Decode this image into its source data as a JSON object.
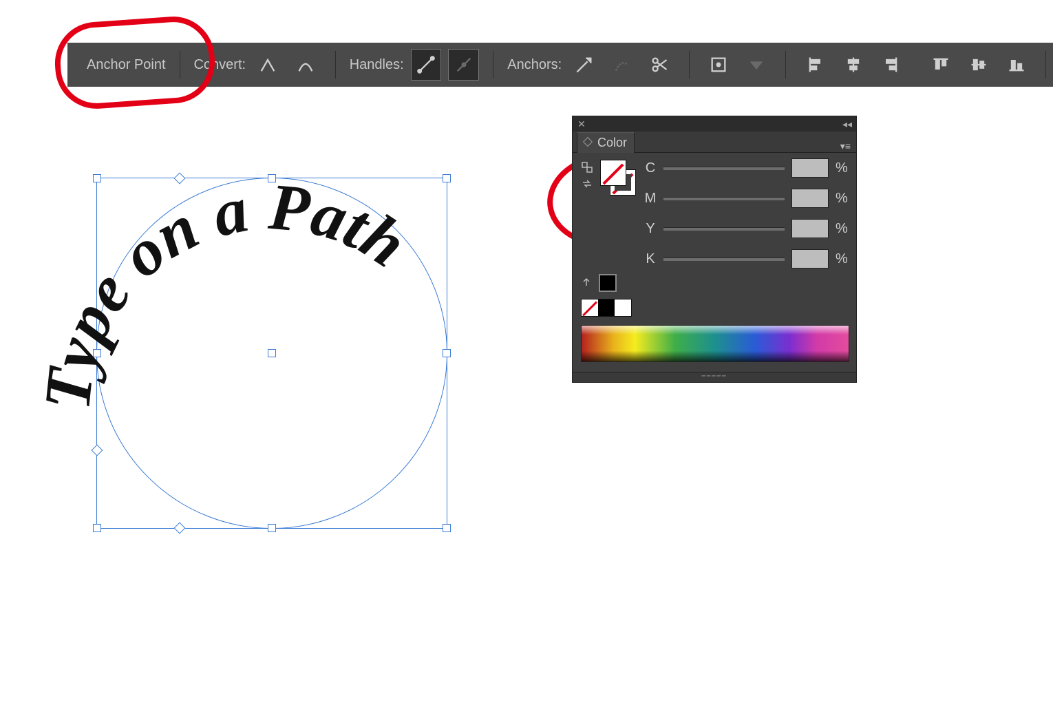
{
  "toolbar": {
    "mode_label": "Anchor Point",
    "convert_label": "Convert:",
    "handles_label": "Handles:",
    "anchors_label": "Anchors:"
  },
  "canvas": {
    "path_text": "Type on a Path"
  },
  "color_panel": {
    "title": "Color",
    "channels": {
      "c": {
        "label": "C",
        "value": "",
        "unit": "%"
      },
      "m": {
        "label": "M",
        "value": "",
        "unit": "%"
      },
      "y": {
        "label": "Y",
        "value": "",
        "unit": "%"
      },
      "k": {
        "label": "K",
        "value": "",
        "unit": "%"
      }
    }
  }
}
